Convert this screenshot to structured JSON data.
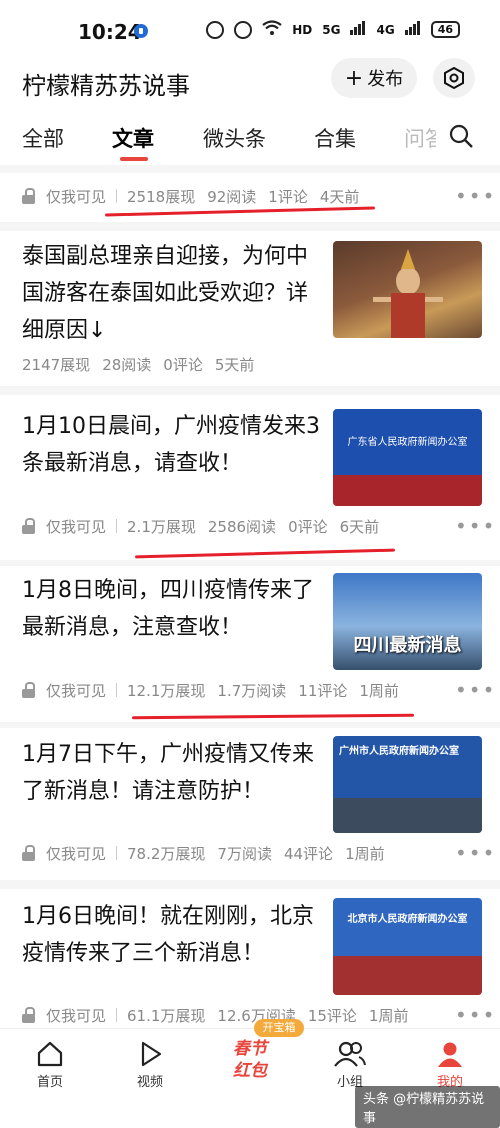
{
  "status_bar": {
    "time": "10:24",
    "battery": "46",
    "network_labels": [
      "HD",
      "5G",
      "4G"
    ]
  },
  "header": {
    "title": "柠檬精苏苏说事",
    "publish_label": "发布",
    "publish_plus": "+"
  },
  "tabs": [
    "全部",
    "文章",
    "微头条",
    "合集",
    "问答"
  ],
  "active_tab": "文章",
  "privacy_label": "仅我可见",
  "items": [
    {
      "stats": [
        "2518展现",
        "92阅读",
        "1评论",
        "4天前"
      ]
    },
    {
      "title": "泰国副总理亲自迎接，为何中国游客在泰国如此受欢迎？详细原因↓",
      "stats": [
        "2147展现",
        "28阅读",
        "0评论",
        "5天前"
      ]
    },
    {
      "title": "1月10日晨间，广州疫情发来3条最新消息，请查收！",
      "stats": [
        "2.1万展现",
        "2586阅读",
        "0评论",
        "6天前"
      ],
      "thumb_text": "广东省人民政府新闻办公室"
    },
    {
      "title": "1月8日晚间，四川疫情传来了最新消息，注意查收！",
      "stats": [
        "12.1万展现",
        "1.7万阅读",
        "11评论",
        "1周前"
      ],
      "thumb_text": "四川最新消息"
    },
    {
      "title": "1月7日下午，广州疫情又传来了新消息！请注意防护！",
      "stats": [
        "78.2万展现",
        "7万阅读",
        "44评论",
        "1周前"
      ],
      "thumb_text": "广州市人民政府新闻办公室"
    },
    {
      "title": "1月6日晚间！就在刚刚，北京疫情传来了三个新消息！",
      "stats": [
        "61.1万展现",
        "12.6万阅读",
        "15评论",
        "1周前"
      ],
      "thumb_text": "北京市人民政府新闻办公室"
    }
  ],
  "bottom_nav": [
    {
      "label": "首页",
      "icon": "home-icon"
    },
    {
      "label": "视频",
      "icon": "video-icon"
    },
    {
      "label": "",
      "icon": "chunjie-hongbao-icon"
    },
    {
      "label": "小组",
      "icon": "group-icon"
    },
    {
      "label": "我的",
      "icon": "profile-icon"
    }
  ],
  "promo": {
    "badge": "开宝箱",
    "text_top": "春节",
    "text_bottom": "红包"
  },
  "watermark": "头条 @柠檬精苏苏说事",
  "colors": {
    "accent": "#e8453c",
    "annotation_red": "#e5202a"
  }
}
